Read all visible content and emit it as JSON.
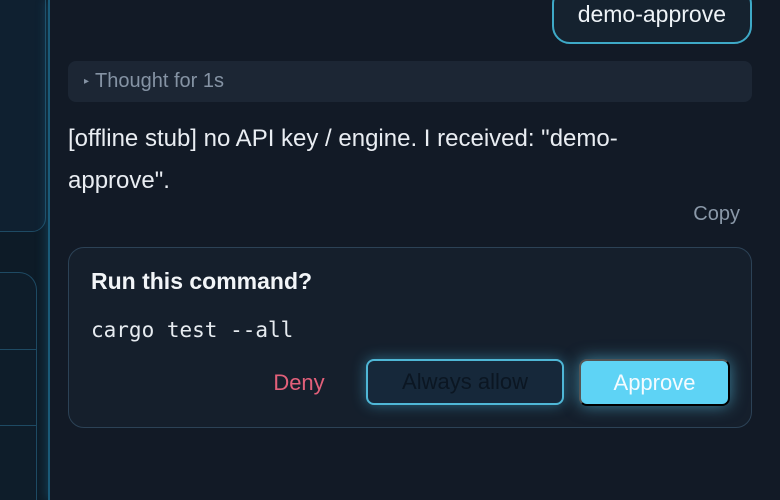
{
  "user_message": {
    "text": "demo-approve"
  },
  "thought": {
    "label": "Thought for 1s",
    "icon": "caret-right-icon"
  },
  "assistant_reply": {
    "text": "[offline stub] no API key / engine. I received: \"demo-approve\".",
    "copy_label": "Copy"
  },
  "approval": {
    "title": "Run this command?",
    "command": "cargo test --all",
    "deny_label": "Deny",
    "always_allow_label": "Always allow",
    "approve_label": "Approve"
  },
  "colors": {
    "accent": "#5ed3f5",
    "accent_border": "#4fb7d6",
    "deny": "#e2607a",
    "background": "#121a26"
  }
}
